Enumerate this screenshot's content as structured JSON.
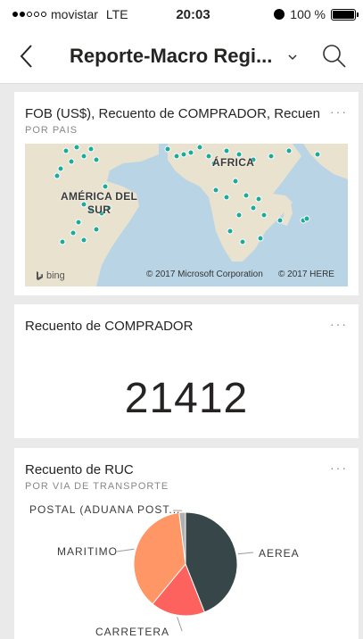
{
  "status": {
    "carrier": "movistar",
    "network": "LTE",
    "time": "20:03",
    "battery": "100 %",
    "battery_level": 1.0,
    "signal_bars": 2
  },
  "header": {
    "title": "Reporte-Macro Regi..."
  },
  "tiles": {
    "map": {
      "title": "FOB (US$), Recuento de COMPRADOR, Recuent...",
      "subtitle": "POR PAIS",
      "labels": {
        "africa": "ÁFRICA",
        "america": "AMÉRICA DEL\nSUR"
      },
      "copyright_ms": "© 2017 Microsoft Corporation",
      "copyright_here": "© 2017 HERE",
      "bing": "bing"
    },
    "kpi": {
      "title": "Recuento de COMPRADOR",
      "value": "21412"
    },
    "pie": {
      "title": "Recuento de RUC",
      "subtitle": "POR VIA DE TRANSPORTE"
    }
  },
  "chart_data": {
    "type": "pie",
    "categories": [
      "AEREA",
      "CARRETERA",
      "MARITIMO",
      "POSTAL (ADUANA POST..."
    ],
    "values": [
      44,
      17,
      37,
      2
    ],
    "colors": [
      "#374649",
      "#fd625e",
      "#fe9666",
      "#b0b0b0"
    ],
    "title": "Recuento de RUC"
  },
  "colors": {
    "map_water": "#b9d4e4",
    "map_land": "#e8e2cf",
    "map_dot": "#1aab9b"
  },
  "icons": {
    "back": "chevron-left-icon",
    "search": "search-icon",
    "caret": "chevron-down-icon",
    "more": "more-options-icon"
  }
}
